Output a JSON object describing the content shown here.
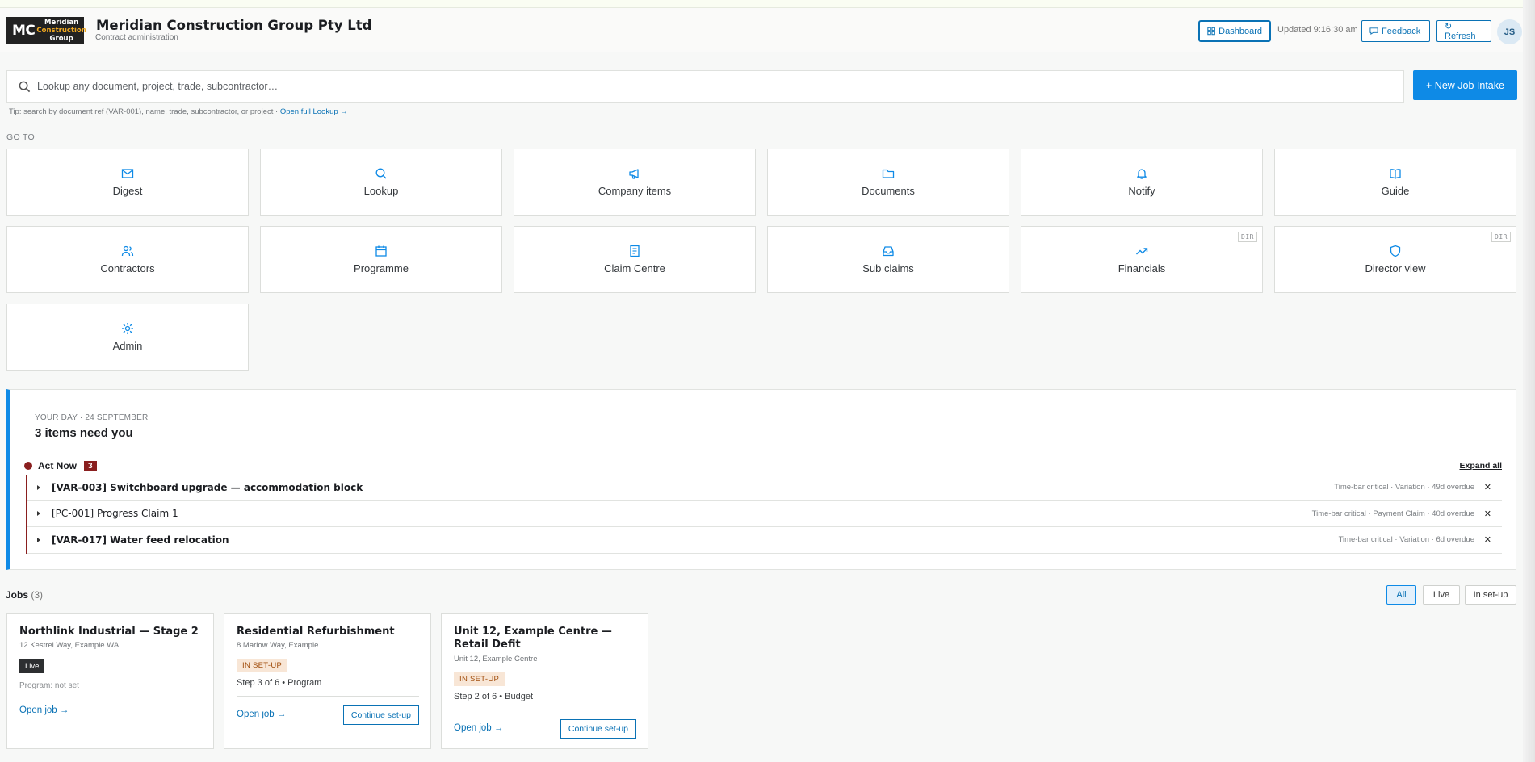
{
  "header": {
    "logo_mc": "MC",
    "logo_line1": "Meridian",
    "logo_line2": "Construction",
    "logo_line3": "Group",
    "company": "Meridian Construction Group Pty Ltd",
    "subtitle": "Contract administration",
    "dashboard_label": "Dashboard",
    "updated": "Updated 9:16:30 am",
    "feedback_label": "Feedback",
    "refresh_label": "↻ Refresh",
    "avatar": "JS"
  },
  "search": {
    "placeholder": "Lookup any document, project, trade, subcontractor…",
    "new_job_label": "+ New Job Intake",
    "tip": "Tip: search by document ref (VAR-001), name, trade, subcontractor, or project · ",
    "tip_link": "Open full Lookup →"
  },
  "goto": {
    "heading": "GO TO",
    "tiles": [
      {
        "label": "Digest",
        "icon": "mail-icon"
      },
      {
        "label": "Lookup",
        "icon": "search-icon"
      },
      {
        "label": "Company items",
        "icon": "megaphone-icon"
      },
      {
        "label": "Documents",
        "icon": "folder-icon"
      },
      {
        "label": "Notify",
        "icon": "bell-icon"
      },
      {
        "label": "Guide",
        "icon": "book-icon"
      },
      {
        "label": "Contractors",
        "icon": "users-icon"
      },
      {
        "label": "Programme",
        "icon": "calendar-icon"
      },
      {
        "label": "Claim Centre",
        "icon": "file-icon"
      },
      {
        "label": "Sub claims",
        "icon": "inbox-icon"
      },
      {
        "label": "Financials",
        "icon": "trending-up-icon",
        "badge": "DIR"
      },
      {
        "label": "Director view",
        "icon": "shield-icon",
        "badge": "DIR"
      },
      {
        "label": "Admin",
        "icon": "gear-icon"
      }
    ]
  },
  "day": {
    "kicker": "YOUR DAY · 24 SEPTEMBER",
    "headline": "3 items need you",
    "act_now_label": "Act Now",
    "act_now_count": "3",
    "expand_all": "Expand all",
    "items": [
      {
        "title": "[VAR-003] Switchboard upgrade — accommodation block",
        "meta": "Time-bar critical · Variation · 49d overdue"
      },
      {
        "title": "[PC-001] Progress Claim 1",
        "meta": "Time-bar critical · Payment Claim · 40d overdue"
      },
      {
        "title": "[VAR-017] Water feed relocation",
        "meta": "Time-bar critical · Variation · 6d overdue"
      }
    ]
  },
  "jobs": {
    "heading": "Jobs",
    "count": "(3)",
    "filters": [
      "All",
      "Live",
      "In set-up"
    ],
    "active_filter": "All",
    "cards": [
      {
        "title": "Northlink Industrial — Stage 2",
        "address": "12 Kestrel Way, Example WA",
        "status": "Live",
        "info": "Program: not set",
        "open": "Open job →"
      },
      {
        "title": "Residential Refurbishment",
        "address": "8 Marlow Way, Example",
        "status": "IN SET-UP",
        "info": "Step 3 of 6 • Program",
        "open": "Open job →",
        "continue": "Continue set-up"
      },
      {
        "title": "Unit 12, Example Centre — Retail Defit",
        "address": "Unit 12, Example Centre",
        "status": "IN SET-UP",
        "info": "Step 2 of 6 • Budget",
        "open": "Open job →",
        "continue": "Continue set-up"
      }
    ]
  },
  "colors": {
    "accent": "#0e8ae6",
    "link": "#0a72b5",
    "critical": "#8a1f1f",
    "setup_bg": "#f8e6d6",
    "setup_text": "#a14d0c"
  }
}
